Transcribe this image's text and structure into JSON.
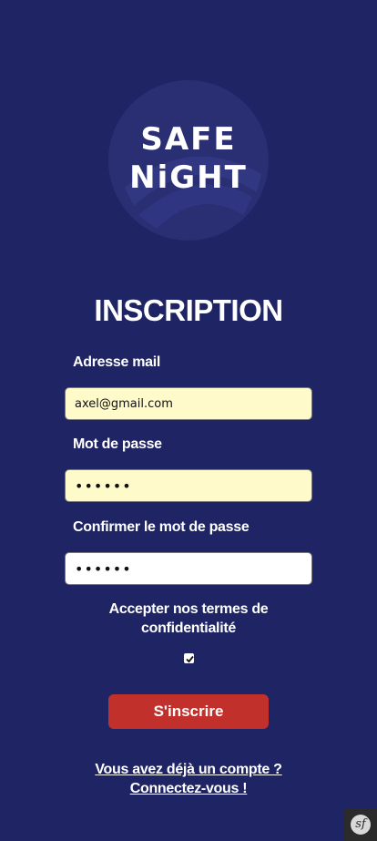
{
  "brand": {
    "logo_line1": "SAFE",
    "logo_line2": "NiGHT"
  },
  "page": {
    "title": "INSCRIPTION"
  },
  "form": {
    "email": {
      "label": "Adresse mail",
      "value": "axel@gmail.com"
    },
    "password": {
      "label": "Mot de passe",
      "value": "••••••"
    },
    "confirm_password": {
      "label": "Confirmer le mot de passe",
      "value": "••••••"
    },
    "terms": {
      "line1": "Accepter nos termes de",
      "line2": "confidentialité",
      "checked": true
    },
    "submit_label": "S'inscrire"
  },
  "footer": {
    "login_line1": "Vous avez déjà un compte ?",
    "login_line2": "Connectez-vous !"
  },
  "toolbar": {
    "symfony_icon": "symfony-icon",
    "symfony_glyph": "sf"
  },
  "colors": {
    "background": "#1f2464",
    "submit_button": "#c2302b",
    "autofill_field": "#fefac9"
  }
}
